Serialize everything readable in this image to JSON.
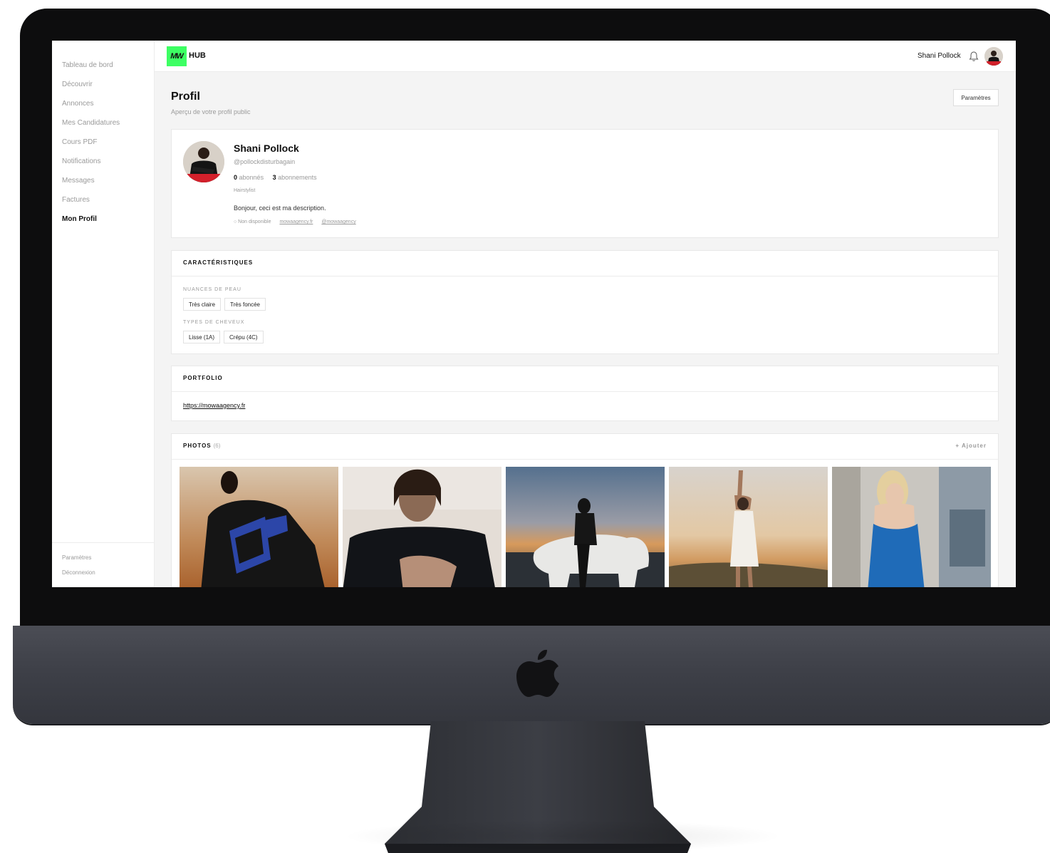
{
  "sidebar": {
    "items": [
      {
        "label": "Tableau de bord"
      },
      {
        "label": "Découvrir"
      },
      {
        "label": "Annonces"
      },
      {
        "label": "Mes Candidatures"
      },
      {
        "label": "Cours PDF"
      },
      {
        "label": "Notifications"
      },
      {
        "label": "Messages"
      },
      {
        "label": "Factures"
      },
      {
        "label": "Mon Profil",
        "active": true
      }
    ],
    "bottom": {
      "settings": "Paramètres",
      "logout": "Déconnexion"
    }
  },
  "topbar": {
    "logo_mark": "MW",
    "logo_text": "HUB",
    "logo_color": "#3dff63",
    "user_name": "Shani Pollock",
    "bell_icon": "bell-icon"
  },
  "page": {
    "title": "Profil",
    "subtitle": "Aperçu de votre profil public",
    "settings_button": "Paramètres"
  },
  "profile": {
    "name": "Shani Pollock",
    "handle": "@pollockdisturbagain",
    "followers_count": "0",
    "followers_label": "abonnés",
    "following_count": "3",
    "following_label": "abonnements",
    "role": "Hairstylist",
    "description": "Bonjour, ceci est ma description.",
    "availability": "○ Non disponible",
    "website": "mowaagency.fr",
    "instagram": "@mowaagency"
  },
  "characteristics": {
    "title": "CARACTÉRISTIQUES",
    "skin_label": "NUANCES DE PEAU",
    "skin_tags": [
      "Très claire",
      "Très foncée"
    ],
    "hair_label": "TYPES DE CHEVEUX",
    "hair_tags": [
      "Lisse (1A)",
      "Crépu (4C)"
    ]
  },
  "portfolio": {
    "title": "PORTFOLIO",
    "url": "https://mowaagency.fr"
  },
  "photos": {
    "title": "PHOTOS",
    "count": "(6)",
    "add_label": "+ Ajouter"
  }
}
